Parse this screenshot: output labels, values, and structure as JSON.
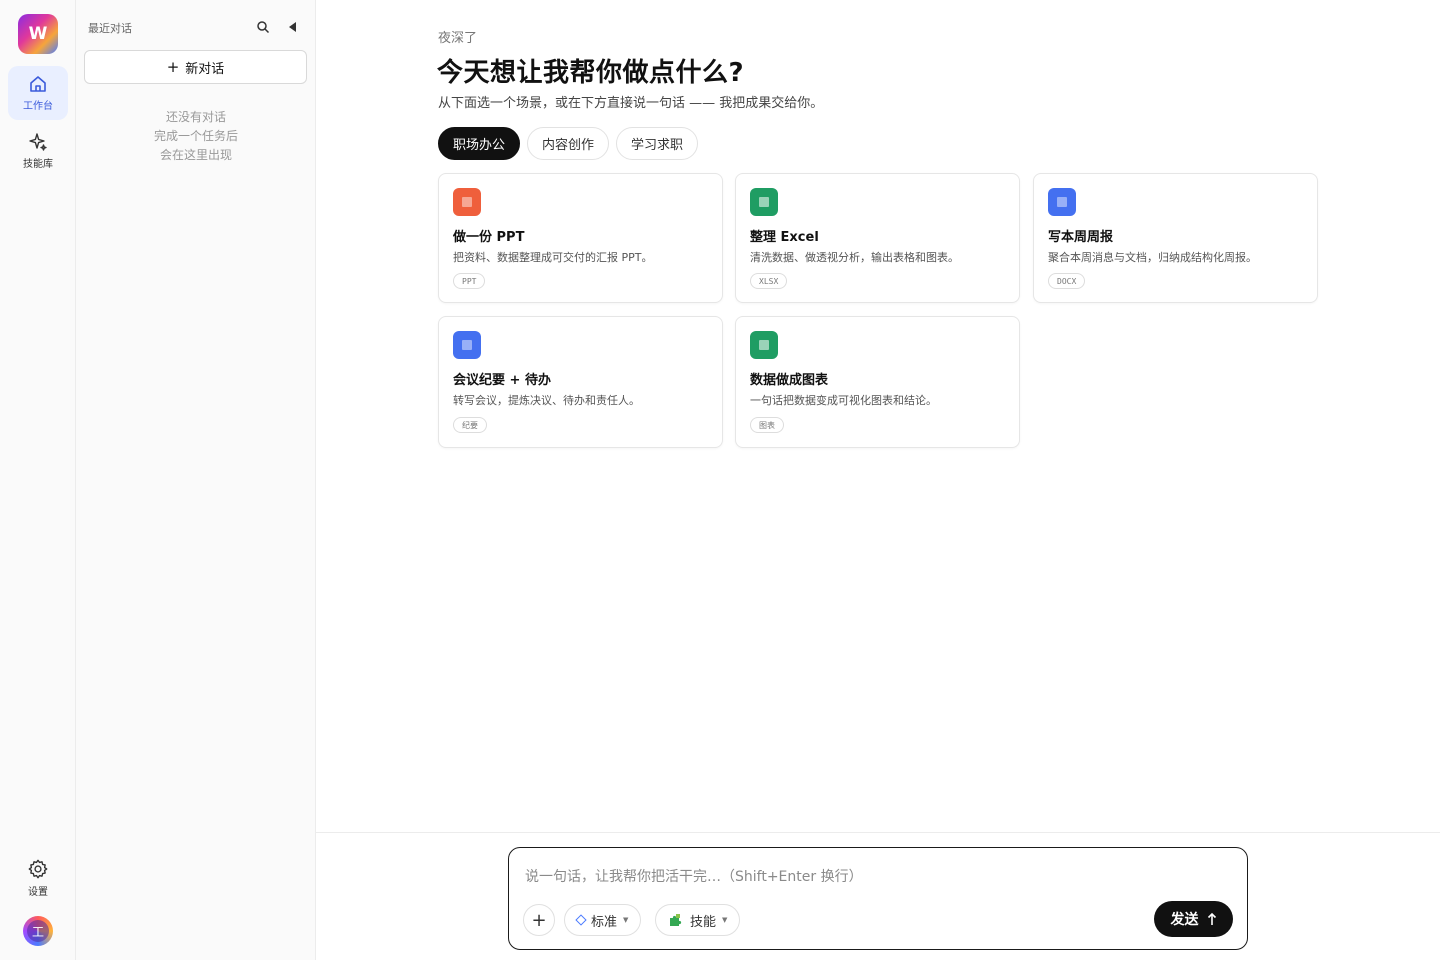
{
  "rail": {
    "logo": "W",
    "items": [
      {
        "label": "工作台",
        "icon": "home-icon"
      },
      {
        "label": "技能库",
        "icon": "sparkle-icon"
      }
    ],
    "settings_label": "设置",
    "avatar_text": "工"
  },
  "convbar": {
    "title": "最近对话",
    "new_chat_label": "新对话",
    "empty_lines": [
      "还没有对话",
      "完成一个任务后",
      "会在这里出现"
    ]
  },
  "main": {
    "greeting_small": "夜深了",
    "title": "今天想让我帮你做点什么?",
    "subtitle": "从下面选一个场景，或在下方直接说一句话 —— 我把成果交给你。",
    "tabs": [
      "职场办公",
      "内容创作",
      "学习求职"
    ],
    "active_tab": 0,
    "cards": [
      {
        "title": "做一份 PPT",
        "desc": "把资料、数据整理成可交付的汇报 PPT。",
        "tag": "PPT",
        "color": "#ef5f3c"
      },
      {
        "title": "整理 Excel",
        "desc": "清洗数据、做透视分析，输出表格和图表。",
        "tag": "XLSX",
        "color": "#1f9d63"
      },
      {
        "title": "写本周周报",
        "desc": "聚合本周消息与文档，归纳成结构化周报。",
        "tag": "DOCX",
        "color": "#4470f0"
      },
      {
        "title": "会议纪要 + 待办",
        "desc": "转写会议，提炼决议、待办和责任人。",
        "tag": "纪要",
        "color": "#4470f0"
      },
      {
        "title": "数据做成图表",
        "desc": "一句话把数据变成可视化图表和结论。",
        "tag": "图表",
        "color": "#1f9d63"
      }
    ]
  },
  "composer": {
    "placeholder": "说一句话，让我帮你把活干完…（Shift+Enter 换行）",
    "mode_label": "标准",
    "skill_label": "技能",
    "send_label": "发送"
  }
}
